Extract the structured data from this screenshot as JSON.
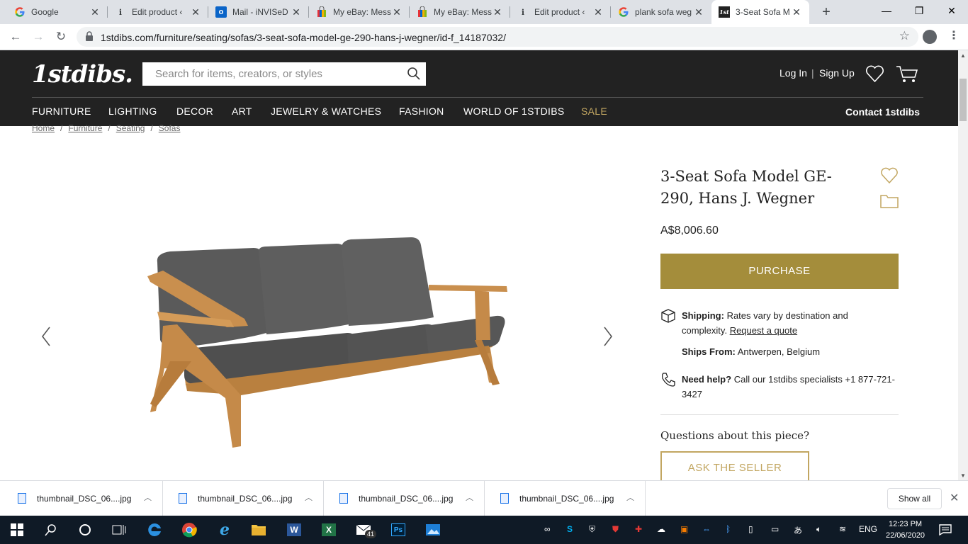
{
  "browser": {
    "tabs": [
      {
        "title": "Google",
        "favicon": "google-icon"
      },
      {
        "title": "Edit product ‹",
        "favicon": "info-icon"
      },
      {
        "title": "Mail - iNVISeD",
        "favicon": "outlook-icon"
      },
      {
        "title": "My eBay: Mess",
        "favicon": "ebay-bag-icon"
      },
      {
        "title": "My eBay: Mess",
        "favicon": "ebay-bag-icon"
      },
      {
        "title": "Edit product ‹",
        "favicon": "info-icon"
      },
      {
        "title": "plank sofa weg",
        "favicon": "google-icon"
      },
      {
        "title": "3-Seat Sofa M",
        "favicon": "1stdibs-icon"
      }
    ],
    "new_tab": "+",
    "url": "1stdibs.com/furniture/seating/sofas/3-seat-sofa-model-ge-290-hans-j-wegner/id-f_14187032/"
  },
  "site": {
    "logo": "1stdibs.",
    "search_placeholder": "Search for items, creators, or styles",
    "login": "Log In",
    "signup": "Sign Up",
    "auth_sep": "|",
    "nav": [
      "FURNITURE",
      "LIGHTING",
      "DECOR",
      "ART",
      "JEWELRY & WATCHES",
      "FASHION",
      "WORLD OF 1STDIBS",
      "SALE"
    ],
    "contact": "Contact 1stdibs",
    "brand_color": "#a48d3b",
    "accent_color": "#c2a661"
  },
  "breadcrumb": [
    "Home",
    "Furniture",
    "Seating",
    "Sofas"
  ],
  "product": {
    "title": "3-Seat Sofa Model GE-290, Hans J. Wegner",
    "price": "A$8,006.60",
    "purchase": "PURCHASE",
    "shipping_label": "Shipping:",
    "shipping_text": "Rates vary by destination and complexity.",
    "shipping_link": "Request a quote",
    "ships_from_label": "Ships From:",
    "ships_from": "Antwerpen, Belgium",
    "help_label": "Need help?",
    "help_text": "Call our 1stdibs specialists +1 877-721-3427",
    "questions": "Questions about this piece?",
    "ask_seller": "ASK THE SELLER"
  },
  "downloads": {
    "files": [
      "thumbnail_DSC_06....jpg",
      "thumbnail_DSC_06....jpg",
      "thumbnail_DSC_06....jpg",
      "thumbnail_DSC_06....jpg"
    ],
    "show_all": "Show all"
  },
  "taskbar": {
    "language": "ENG",
    "time": "12:23 PM",
    "date": "22/06/2020",
    "mail_badge": "41"
  }
}
